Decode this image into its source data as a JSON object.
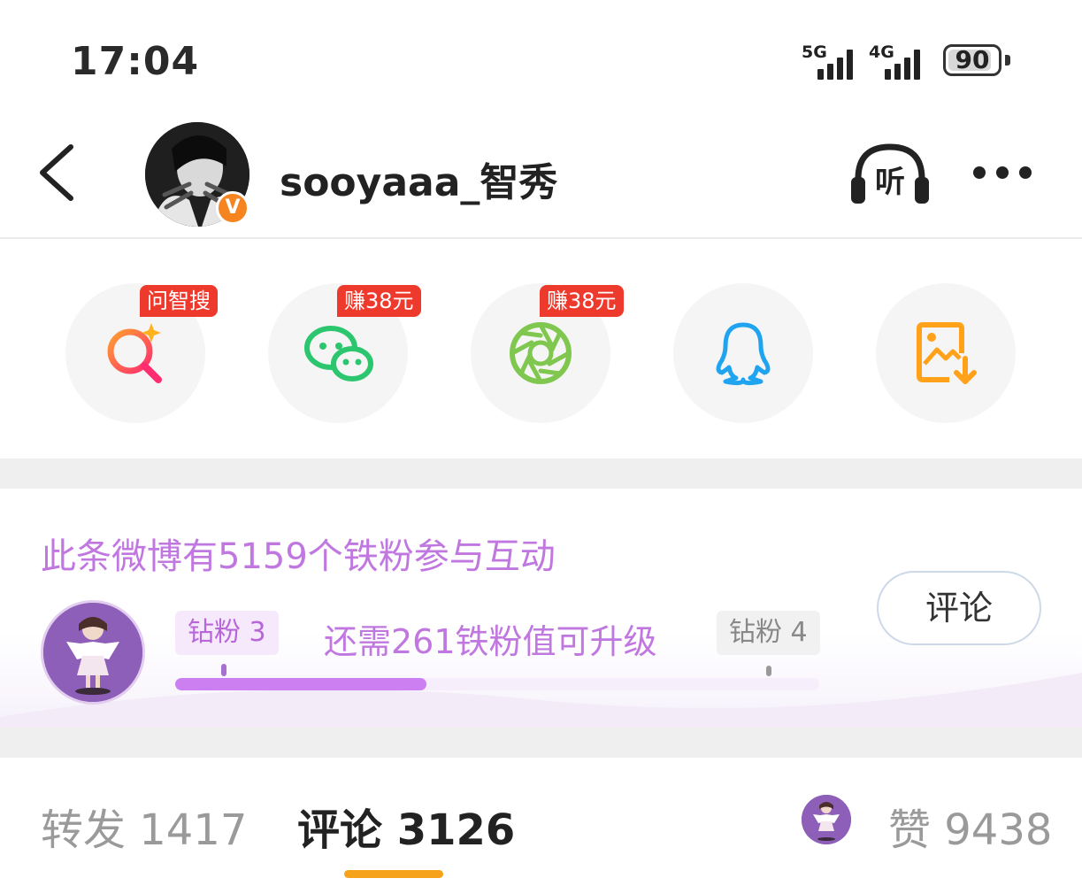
{
  "status_bar": {
    "time": "17:04",
    "network_1": "5G",
    "network_2": "4G",
    "battery": "90",
    "battery_level": 0.9
  },
  "header": {
    "back_icon": "chevron-left-icon",
    "username": "sooyaaa_智秀",
    "verified_badge": "V",
    "listen_label": "听",
    "more_icon": "more-horizontal-icon"
  },
  "share_targets": [
    {
      "name": "search",
      "icon": "ai-search-icon",
      "badge": "问智搜"
    },
    {
      "name": "wechat",
      "icon": "wechat-icon",
      "badge": "赚38元"
    },
    {
      "name": "moments",
      "icon": "moments-aperture-icon",
      "badge": "赚38元"
    },
    {
      "name": "qq",
      "icon": "qq-penguin-icon",
      "badge": ""
    },
    {
      "name": "save-image",
      "icon": "image-download-icon",
      "badge": ""
    }
  ],
  "fan_panel": {
    "title": "此条微博有5159个铁粉参与互动",
    "current_level": "钻粉 3",
    "next_level": "钻粉 4",
    "need_text": "还需261铁粉值可升级",
    "progress": 0.39,
    "comment_button": "评论"
  },
  "tabs": {
    "repost": "转发 1417",
    "comment": "评论 3126",
    "like": "赞 9438"
  },
  "colors": {
    "accent_purple": "#c077e0",
    "tab_underline": "#f7a21b",
    "badge_red": "#ee3a2c",
    "verified_orange": "#f6851f"
  }
}
